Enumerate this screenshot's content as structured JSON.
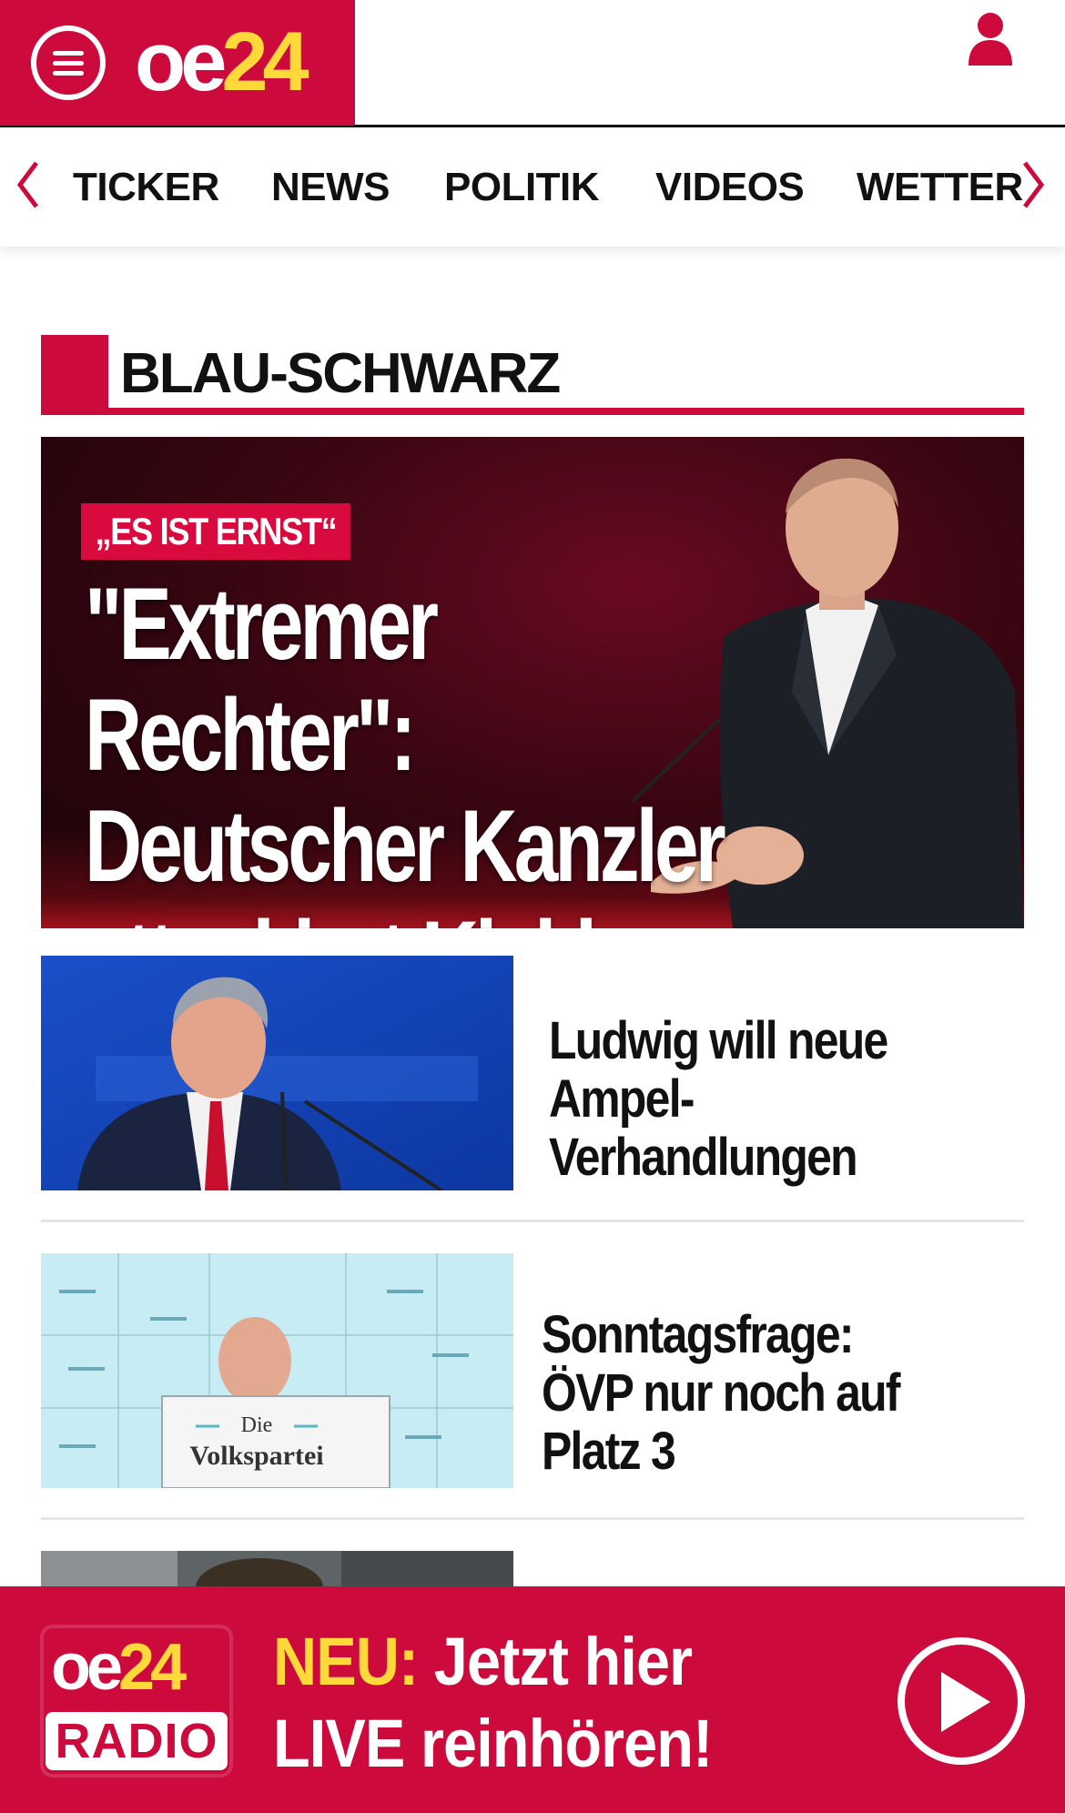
{
  "header": {
    "logo": {
      "oe": "oe",
      "num": "24"
    },
    "menu_icon": "hamburger-menu-icon",
    "user_icon": "user-icon",
    "brand_color": "#cc0a3c",
    "logo_accent": "#ffd83a"
  },
  "nav": {
    "items": [
      "TICKER",
      "NEWS",
      "POLITIK",
      "VIDEOS",
      "WETTER"
    ],
    "left_arrow_icon": "chevron-left-icon",
    "right_arrow_icon": "chevron-right-icon"
  },
  "section": {
    "title": "BLAU-SCHWARZ"
  },
  "hero": {
    "kicker": "„ES IST ERNST“",
    "headline": "\"Extremer Rechter\": Deutscher Kanzler attackiert Kickl"
  },
  "articles": [
    {
      "headline": "Ludwig will neue Ampel-Verhandlungen"
    },
    {
      "headline": "Sonntagsfrage: ÖVP nur noch auf Platz 3"
    }
  ],
  "thumb_text": {
    "podium_top": "Die",
    "podium_bottom": "Volkspartei"
  },
  "radio": {
    "logo": {
      "oe": "oe",
      "num": "24",
      "label": "RADIO"
    },
    "neu": "NEU:",
    "line1_rest": " Jetzt hier",
    "line2": "LIVE reinhören!",
    "play_icon": "play-icon"
  }
}
